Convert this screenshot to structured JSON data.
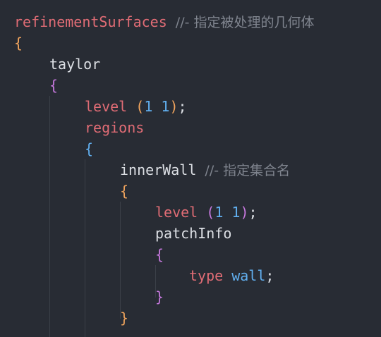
{
  "editor": {
    "theme": "dark",
    "colors": {
      "background": "#282c34",
      "keyword_red": "#e06c75",
      "identifier": "#dcdfe4",
      "comment": "#7f848e",
      "number": "#61afef",
      "brace_level1": "#f0a45d",
      "brace_level2": "#c678dd",
      "brace_level3": "#61afef"
    },
    "lines": {
      "l1": {
        "name": "refinementSurfaces",
        "comment": "//- 指定被处理的几何体"
      },
      "l2": {
        "brace": "{"
      },
      "l3": {
        "name": "taylor"
      },
      "l4": {
        "brace": "{"
      },
      "l5": {
        "key": "level",
        "open": "(",
        "v1": "1",
        "v2": "1",
        "close": ")",
        "semi": ";"
      },
      "l6": {
        "key": "regions"
      },
      "l7": {
        "brace": "{"
      },
      "l8": {
        "name": "innerWall",
        "comment": "//- 指定集合名"
      },
      "l9": {
        "brace": "{"
      },
      "l10": {
        "key": "level",
        "open": "(",
        "v1": "1",
        "v2": "1",
        "close": ")",
        "semi": ";"
      },
      "l11": {
        "name": "patchInfo"
      },
      "l12": {
        "brace": "{"
      },
      "l13": {
        "key": "type",
        "value": "wall",
        "semi": ";"
      },
      "l14": {
        "brace": "}"
      },
      "l15": {
        "brace": "}"
      }
    }
  }
}
